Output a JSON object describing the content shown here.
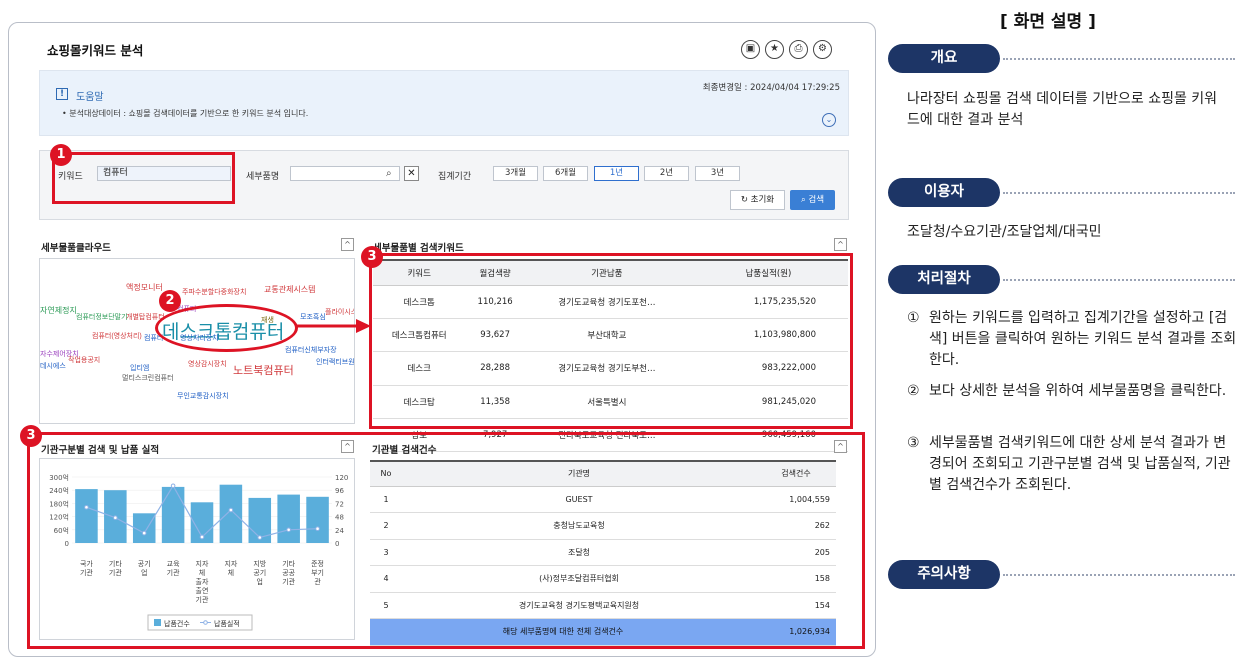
{
  "page_title": "쇼핑몰키워드 분석",
  "toolbar_icons": [
    "save-icon",
    "star-icon",
    "print-icon",
    "settings-icon"
  ],
  "help": {
    "last_updated": "최종변경일 : 2024/04/04 17:29:25",
    "title": "도움말",
    "icon": "!",
    "desc": "• 분석대상데이터 : 쇼핑몰 검색데이터를 기반으로 한 키워드 분석 입니다.",
    "toggle": "⌄"
  },
  "search": {
    "keyword_label": "키워드",
    "keyword_value": "컴퓨터",
    "item_label": "세부품명",
    "item_value": "",
    "period_label": "집계기간",
    "periods": [
      "3개월",
      "6개월",
      "1년",
      "2년",
      "3년"
    ],
    "selected_period": "1년",
    "reset_label": "초기화",
    "search_label": "검색"
  },
  "badges": {
    "b1": "1",
    "b2": "2",
    "b3a": "3",
    "b3b": "3"
  },
  "cloud": {
    "title": "세부물품클라우드",
    "collapse": "^",
    "words": [
      {
        "text": "액정모니터",
        "color": "#d0383b",
        "size": 8
      },
      {
        "text": "주파수분할다중화장치",
        "color": "#d0383b",
        "size": 7
      },
      {
        "text": "교통관제시스템",
        "color": "#d0383b",
        "size": 8
      },
      {
        "text": "자연제정지",
        "color": "#2a9a55",
        "size": 8
      },
      {
        "text": "컴퓨터정보단말기",
        "color": "#2a9a55",
        "size": 7
      },
      {
        "text": "개별탑컴퓨터",
        "color": "#d0383b",
        "size": 7
      },
      {
        "text": "컴퓨터",
        "color": "#9a3fbe",
        "size": 7
      },
      {
        "text": "재생",
        "color": "#7a6a10",
        "size": 7
      },
      {
        "text": "모조흑심",
        "color": "#1e5ec4",
        "size": 7
      },
      {
        "text": "플라이시스템",
        "color": "#d0383b",
        "size": 7
      },
      {
        "text": "데스크톱컴퓨터",
        "color": "#1a8fa8",
        "size": 19
      },
      {
        "text": "컴퓨터(영상처리)",
        "color": "#d0383b",
        "size": 7
      },
      {
        "text": "컴퓨터",
        "color": "#1e5ec4",
        "size": 7
      },
      {
        "text": "영상처리장치",
        "color": "#1e5ec4",
        "size": 7
      },
      {
        "text": "컴퓨터신체부자장",
        "color": "#1e5ec4",
        "size": 7
      },
      {
        "text": "자수제어장치",
        "color": "#9a3fbe",
        "size": 7
      },
      {
        "text": "작업용공지",
        "color": "#d0383b",
        "size": 7
      },
      {
        "text": "데시에스",
        "color": "#1e5ec4",
        "size": 7
      },
      {
        "text": "영상감시장치",
        "color": "#d0383b",
        "size": 7
      },
      {
        "text": "인터랙티브원",
        "color": "#1e5ec4",
        "size": 7
      },
      {
        "text": "노트북컴퓨터",
        "color": "#d0383b",
        "size": 11
      },
      {
        "text": "입티엠",
        "color": "#1e5ec4",
        "size": 7
      },
      {
        "text": "멀티스크린컴퓨터",
        "color": "#555555",
        "size": 7
      },
      {
        "text": "무인교통감시장치",
        "color": "#1e5ec4",
        "size": 7
      }
    ]
  },
  "keyword_table": {
    "title": "세부물품별 검색키워드",
    "collapse": "^",
    "headers": [
      "키워드",
      "월검색량",
      "기관납품",
      "납품실적(원)"
    ],
    "rows": [
      [
        "데스크톱",
        "110,216",
        "경기도교육청 경기도포천…",
        "1,175,235,520"
      ],
      [
        "데스크톱컴퓨터",
        "93,627",
        "부산대학교",
        "1,103,980,800"
      ],
      [
        "데스크",
        "28,288",
        "경기도교육청 경기도부천…",
        "983,222,000"
      ],
      [
        "데스크탑",
        "11,358",
        "서울특별시",
        "981,245,020"
      ],
      [
        "삼보",
        "7,927",
        "전라북도교육청 전라북도…",
        "960,459,160"
      ]
    ]
  },
  "chart_panel": {
    "title": "기관구분별 검색 및 납품 실적",
    "collapse": "^"
  },
  "chart_data": {
    "type": "bar",
    "categories": [
      "국가기관",
      "기타기관",
      "공기업",
      "교육기관",
      "지자체 출자출연기관",
      "지자체",
      "지방공기업",
      "기타공공기관",
      "준정부기관"
    ],
    "series": [
      {
        "name": "납품건수",
        "type": "bar",
        "axis": "left",
        "values": [
          245,
          240,
          135,
          255,
          185,
          265,
          205,
          220,
          210
        ]
      },
      {
        "name": "납품실적",
        "type": "line",
        "axis": "right",
        "values": [
          65,
          46,
          18,
          104,
          11,
          60,
          10,
          24,
          26
        ]
      }
    ],
    "y_left_ticks": [
      "300억",
      "240억",
      "180억",
      "120억",
      "60억",
      "0"
    ],
    "y_right_ticks": [
      "120",
      "96",
      "72",
      "48",
      "24",
      "0"
    ],
    "ylim_left": [
      0,
      300
    ],
    "ylim_right": [
      0,
      120
    ],
    "colors": {
      "bar": "#5aaedb",
      "line": "#8fb2e6"
    }
  },
  "inst_table": {
    "title": "기관별 검색건수",
    "collapse": "^",
    "headers": [
      "No",
      "기관명",
      "검색건수"
    ],
    "rows": [
      [
        "1",
        "GUEST",
        "1,004,559"
      ],
      [
        "2",
        "충청남도교육청",
        "262"
      ],
      [
        "3",
        "조달청",
        "205"
      ],
      [
        "4",
        "(사)정부조달컴퓨터협회",
        "158"
      ],
      [
        "5",
        "경기도교육청 경기도평택교육지원청",
        "154"
      ]
    ],
    "total_label": "해당 세부품명에 대한 전체 검색건수",
    "total_value": "1,026,934"
  },
  "right_panel": {
    "heading": "[ 화면 설명 ]",
    "overview_title": "개요",
    "overview_text": "나라장터 쇼핑몰 검색 데이터를 기반으로 쇼핑몰 키워드에 대한 결과 분석",
    "users_title": "이용자",
    "users_text": "조달청/수요기관/조달업체/대국민",
    "process_title": "처리절차",
    "steps": [
      {
        "n": "①",
        "t": "원하는 키워드를 입력하고 집계기간을 설정하고 [검색] 버튼을 클릭하여 원하는 키워드 분석 결과를 조회한다."
      },
      {
        "n": "②",
        "t": "보다 상세한 분석을 위하여 세부물품명을 클릭한다."
      },
      {
        "n": "③",
        "t": "세부물품별 검색키워드에 대한 상세 분석 결과가 변경되어 조회되고 기관구분별 검색 및 납품실적, 기관별 검색건수가 조회된다."
      }
    ],
    "caution_title": "주의사항"
  }
}
